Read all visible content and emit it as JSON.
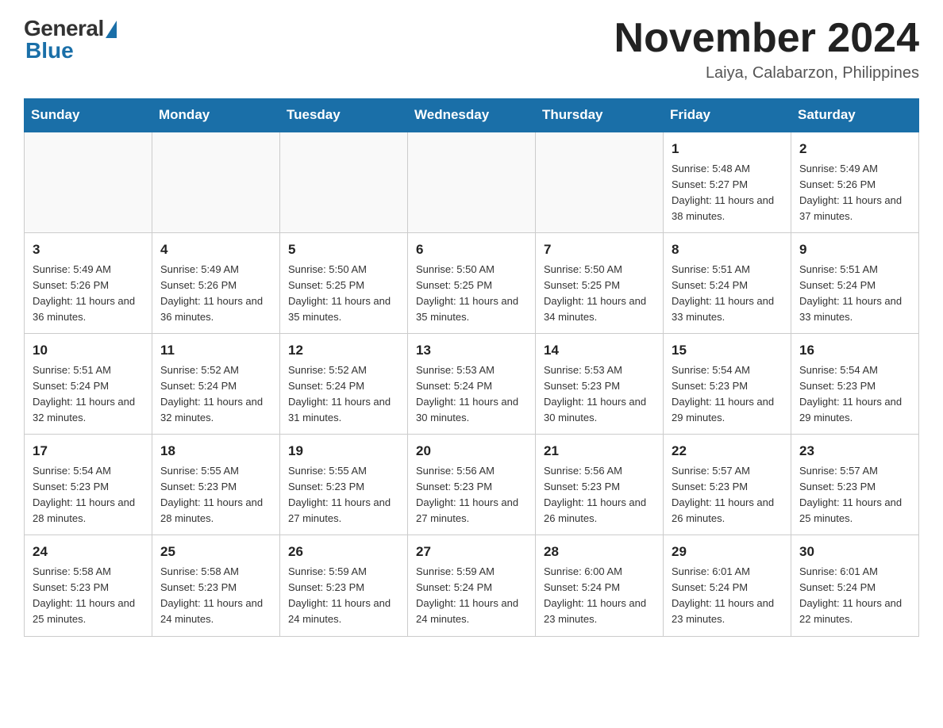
{
  "header": {
    "logo_general": "General",
    "logo_blue": "Blue",
    "month_title": "November 2024",
    "location": "Laiya, Calabarzon, Philippines"
  },
  "weekdays": [
    "Sunday",
    "Monday",
    "Tuesday",
    "Wednesday",
    "Thursday",
    "Friday",
    "Saturday"
  ],
  "weeks": [
    [
      {
        "day": "",
        "info": ""
      },
      {
        "day": "",
        "info": ""
      },
      {
        "day": "",
        "info": ""
      },
      {
        "day": "",
        "info": ""
      },
      {
        "day": "",
        "info": ""
      },
      {
        "day": "1",
        "info": "Sunrise: 5:48 AM\nSunset: 5:27 PM\nDaylight: 11 hours and 38 minutes."
      },
      {
        "day": "2",
        "info": "Sunrise: 5:49 AM\nSunset: 5:26 PM\nDaylight: 11 hours and 37 minutes."
      }
    ],
    [
      {
        "day": "3",
        "info": "Sunrise: 5:49 AM\nSunset: 5:26 PM\nDaylight: 11 hours and 36 minutes."
      },
      {
        "day": "4",
        "info": "Sunrise: 5:49 AM\nSunset: 5:26 PM\nDaylight: 11 hours and 36 minutes."
      },
      {
        "day": "5",
        "info": "Sunrise: 5:50 AM\nSunset: 5:25 PM\nDaylight: 11 hours and 35 minutes."
      },
      {
        "day": "6",
        "info": "Sunrise: 5:50 AM\nSunset: 5:25 PM\nDaylight: 11 hours and 35 minutes."
      },
      {
        "day": "7",
        "info": "Sunrise: 5:50 AM\nSunset: 5:25 PM\nDaylight: 11 hours and 34 minutes."
      },
      {
        "day": "8",
        "info": "Sunrise: 5:51 AM\nSunset: 5:24 PM\nDaylight: 11 hours and 33 minutes."
      },
      {
        "day": "9",
        "info": "Sunrise: 5:51 AM\nSunset: 5:24 PM\nDaylight: 11 hours and 33 minutes."
      }
    ],
    [
      {
        "day": "10",
        "info": "Sunrise: 5:51 AM\nSunset: 5:24 PM\nDaylight: 11 hours and 32 minutes."
      },
      {
        "day": "11",
        "info": "Sunrise: 5:52 AM\nSunset: 5:24 PM\nDaylight: 11 hours and 32 minutes."
      },
      {
        "day": "12",
        "info": "Sunrise: 5:52 AM\nSunset: 5:24 PM\nDaylight: 11 hours and 31 minutes."
      },
      {
        "day": "13",
        "info": "Sunrise: 5:53 AM\nSunset: 5:24 PM\nDaylight: 11 hours and 30 minutes."
      },
      {
        "day": "14",
        "info": "Sunrise: 5:53 AM\nSunset: 5:23 PM\nDaylight: 11 hours and 30 minutes."
      },
      {
        "day": "15",
        "info": "Sunrise: 5:54 AM\nSunset: 5:23 PM\nDaylight: 11 hours and 29 minutes."
      },
      {
        "day": "16",
        "info": "Sunrise: 5:54 AM\nSunset: 5:23 PM\nDaylight: 11 hours and 29 minutes."
      }
    ],
    [
      {
        "day": "17",
        "info": "Sunrise: 5:54 AM\nSunset: 5:23 PM\nDaylight: 11 hours and 28 minutes."
      },
      {
        "day": "18",
        "info": "Sunrise: 5:55 AM\nSunset: 5:23 PM\nDaylight: 11 hours and 28 minutes."
      },
      {
        "day": "19",
        "info": "Sunrise: 5:55 AM\nSunset: 5:23 PM\nDaylight: 11 hours and 27 minutes."
      },
      {
        "day": "20",
        "info": "Sunrise: 5:56 AM\nSunset: 5:23 PM\nDaylight: 11 hours and 27 minutes."
      },
      {
        "day": "21",
        "info": "Sunrise: 5:56 AM\nSunset: 5:23 PM\nDaylight: 11 hours and 26 minutes."
      },
      {
        "day": "22",
        "info": "Sunrise: 5:57 AM\nSunset: 5:23 PM\nDaylight: 11 hours and 26 minutes."
      },
      {
        "day": "23",
        "info": "Sunrise: 5:57 AM\nSunset: 5:23 PM\nDaylight: 11 hours and 25 minutes."
      }
    ],
    [
      {
        "day": "24",
        "info": "Sunrise: 5:58 AM\nSunset: 5:23 PM\nDaylight: 11 hours and 25 minutes."
      },
      {
        "day": "25",
        "info": "Sunrise: 5:58 AM\nSunset: 5:23 PM\nDaylight: 11 hours and 24 minutes."
      },
      {
        "day": "26",
        "info": "Sunrise: 5:59 AM\nSunset: 5:23 PM\nDaylight: 11 hours and 24 minutes."
      },
      {
        "day": "27",
        "info": "Sunrise: 5:59 AM\nSunset: 5:24 PM\nDaylight: 11 hours and 24 minutes."
      },
      {
        "day": "28",
        "info": "Sunrise: 6:00 AM\nSunset: 5:24 PM\nDaylight: 11 hours and 23 minutes."
      },
      {
        "day": "29",
        "info": "Sunrise: 6:01 AM\nSunset: 5:24 PM\nDaylight: 11 hours and 23 minutes."
      },
      {
        "day": "30",
        "info": "Sunrise: 6:01 AM\nSunset: 5:24 PM\nDaylight: 11 hours and 22 minutes."
      }
    ]
  ]
}
